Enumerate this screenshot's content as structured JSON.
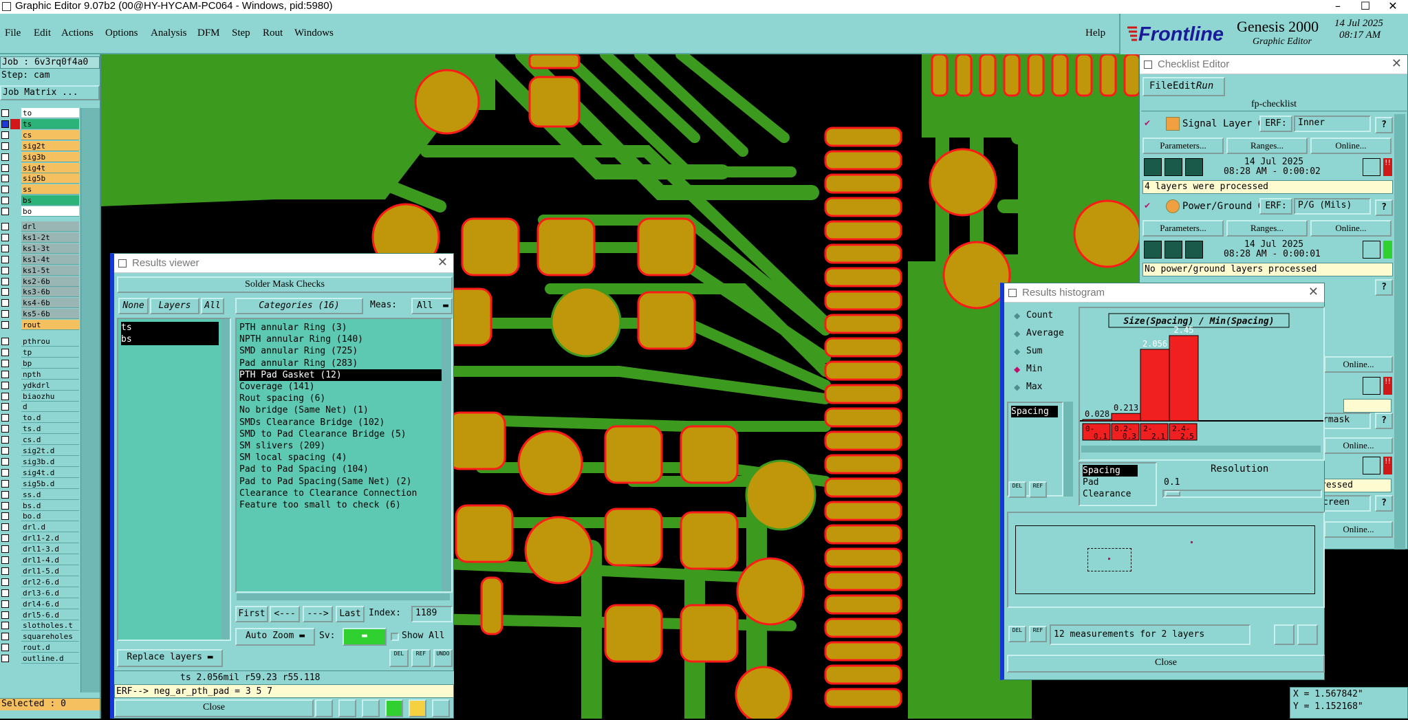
{
  "titlebar": {
    "title": "Graphic Editor 9.07b2 (00@HY-HYCAM-PC064 - Windows, pid:5980)",
    "minimize": "–",
    "maximize": "☐",
    "close": "✕"
  },
  "menu": {
    "items": [
      "File",
      "Edit",
      "Actions",
      "Options",
      "Analysis",
      "DFM",
      "Step",
      "Rout",
      "Windows"
    ],
    "help": "Help"
  },
  "brand": {
    "logo": "Frontline",
    "product": "Genesis 2000",
    "subtitle": "Graphic Editor",
    "date": "14 Jul 2025",
    "time": "08:17 AM"
  },
  "left": {
    "job": "Job : 6v3rq0f4a0",
    "step": "Step: cam",
    "job_matrix": "Job Matrix ...",
    "selected": "Selected : 0",
    "layers": [
      {
        "name": "to",
        "color": "#ffffff",
        "checked": false
      },
      {
        "name": "ts",
        "color": "#2bb37a",
        "checked": true
      },
      {
        "name": "cs",
        "color": "#f5c060",
        "checked": false
      },
      {
        "name": "sig2t",
        "color": "#f5c060",
        "checked": false
      },
      {
        "name": "sig3b",
        "color": "#f5c060",
        "checked": false
      },
      {
        "name": "sig4t",
        "color": "#f5c060",
        "checked": false
      },
      {
        "name": "sig5b",
        "color": "#f5c060",
        "checked": false
      },
      {
        "name": "ss",
        "color": "#f5c060",
        "checked": false
      },
      {
        "name": "bs",
        "color": "#2bb37a",
        "checked": false
      },
      {
        "name": "bo",
        "color": "#ffffff",
        "checked": false
      },
      {
        "name": "drl",
        "color": "#9ab6b4",
        "checked": false
      },
      {
        "name": "ks1-2t",
        "color": "#9ab6b4",
        "checked": false
      },
      {
        "name": "ks1-3t",
        "color": "#9ab6b4",
        "checked": false
      },
      {
        "name": "ks1-4t",
        "color": "#9ab6b4",
        "checked": false
      },
      {
        "name": "ks1-5t",
        "color": "#9ab6b4",
        "checked": false
      },
      {
        "name": "ks2-6b",
        "color": "#9ab6b4",
        "checked": false
      },
      {
        "name": "ks3-6b",
        "color": "#9ab6b4",
        "checked": false
      },
      {
        "name": "ks4-6b",
        "color": "#9ab6b4",
        "checked": false
      },
      {
        "name": "ks5-6b",
        "color": "#9ab6b4",
        "checked": false
      },
      {
        "name": "rout",
        "color": "#f5c060",
        "checked": false
      },
      {
        "name": "pthrou",
        "color": "#8fd6d2",
        "checked": false
      },
      {
        "name": "tp",
        "color": "#8fd6d2",
        "checked": false
      },
      {
        "name": "bp",
        "color": "#8fd6d2",
        "checked": false
      },
      {
        "name": "npth",
        "color": "#8fd6d2",
        "checked": false
      },
      {
        "name": "ydkdrl",
        "color": "#8fd6d2",
        "checked": false
      },
      {
        "name": "biaozhu",
        "color": "#8fd6d2",
        "checked": false
      },
      {
        "name": "d",
        "color": "#8fd6d2",
        "checked": false
      },
      {
        "name": "to.d",
        "color": "#8fd6d2",
        "checked": false
      },
      {
        "name": "ts.d",
        "color": "#8fd6d2",
        "checked": false
      },
      {
        "name": "cs.d",
        "color": "#8fd6d2",
        "checked": false
      },
      {
        "name": "sig2t.d",
        "color": "#8fd6d2",
        "checked": false
      },
      {
        "name": "sig3b.d",
        "color": "#8fd6d2",
        "checked": false
      },
      {
        "name": "sig4t.d",
        "color": "#8fd6d2",
        "checked": false
      },
      {
        "name": "sig5b.d",
        "color": "#8fd6d2",
        "checked": false
      },
      {
        "name": "ss.d",
        "color": "#8fd6d2",
        "checked": false
      },
      {
        "name": "bs.d",
        "color": "#8fd6d2",
        "checked": false
      },
      {
        "name": "bo.d",
        "color": "#8fd6d2",
        "checked": false
      },
      {
        "name": "drl.d",
        "color": "#8fd6d2",
        "checked": false
      },
      {
        "name": "drl1-2.d",
        "color": "#8fd6d2",
        "checked": false
      },
      {
        "name": "drl1-3.d",
        "color": "#8fd6d2",
        "checked": false
      },
      {
        "name": "drl1-4.d",
        "color": "#8fd6d2",
        "checked": false
      },
      {
        "name": "drl1-5.d",
        "color": "#8fd6d2",
        "checked": false
      },
      {
        "name": "drl2-6.d",
        "color": "#8fd6d2",
        "checked": false
      },
      {
        "name": "drl3-6.d",
        "color": "#8fd6d2",
        "checked": false
      },
      {
        "name": "drl4-6.d",
        "color": "#8fd6d2",
        "checked": false
      },
      {
        "name": "drl5-6.d",
        "color": "#8fd6d2",
        "checked": false
      },
      {
        "name": "slotholes.t",
        "color": "#8fd6d2",
        "checked": false
      },
      {
        "name": "squareholes",
        "color": "#8fd6d2",
        "checked": false
      },
      {
        "name": "rout.d",
        "color": "#8fd6d2",
        "checked": false
      },
      {
        "name": "outline.d",
        "color": "#8fd6d2",
        "checked": false
      }
    ]
  },
  "results_viewer": {
    "title": "Results viewer",
    "header": "Solder Mask Checks",
    "none": "None",
    "layers": "Layers",
    "all": "All",
    "categories": "Categories (16)",
    "meas_label": "Meas:",
    "meas_value": "All",
    "layer_list": [
      "ts",
      "bs"
    ],
    "category_list": [
      "PTH annular Ring (3)",
      "NPTH annular Ring (140)",
      "SMD annular Ring (725)",
      "Pad annular Ring (283)",
      "PTH Pad Gasket (12)",
      "Coverage (141)",
      "Rout spacing (6)",
      "No bridge (Same Net) (1)",
      "SMDs Clearance Bridge (102)",
      "SMD to Pad Clearance Bridge (5)",
      "SM slivers (209)",
      "SM local spacing (4)",
      "Pad to Pad Spacing (104)",
      "Pad to Pad Spacing(Same Net) (2)",
      "Clearance to Clearance Connection",
      "Feature too small to check (6)"
    ],
    "selected_index": 4,
    "first": "First",
    "prev": "<---",
    "next": "--->",
    "last": "Last",
    "index_label": "Index:",
    "index_value": "1189",
    "auto_zoom": "Auto Zoom",
    "sv": "Sv:",
    "show_all": "Show All",
    "replace_layers": "Replace layers",
    "status": "ts 2.056mil  r59.23  r55.118",
    "erf": "ERF--> neg_ar_pth_pad = 3 5 7",
    "close": "Close",
    "del": "DEL",
    "ref": "REF",
    "undo": "UNDO"
  },
  "checklist": {
    "title": "Checklist Editor",
    "menu": [
      "File",
      "Edit",
      "Run"
    ],
    "name": "fp-checklist",
    "actions": [
      {
        "name": "Signal Layer Ch",
        "erf": "ERF:",
        "erf_value": "Inner",
        "params": "Parameters...",
        "ranges": "Ranges...",
        "online": "Online...",
        "date": "14 Jul 2025",
        "time": "08:28 AM - 0:00:02",
        "message": "4 layers were processed",
        "status_color": "#d01818"
      },
      {
        "name": "Power/Ground C",
        "erf": "ERF:",
        "erf_value": "P/G (Mils)",
        "params": "Parameters...",
        "ranges": "Ranges...",
        "online": "Online...",
        "date": "14 Jul 2025",
        "time": "08:28 AM - 0:00:01",
        "message": "No power/ground layers processed",
        "status_color": "#2fd02f"
      }
    ],
    "partial": [
      "Online...",
      "Online...",
      "rmask",
      "Online...",
      "ressed",
      "creen",
      "Online..."
    ],
    "help": "?"
  },
  "histogram": {
    "title": "Results histogram",
    "options": [
      "Count",
      "Average",
      "Sum",
      "Min",
      "Max"
    ],
    "selected_option": "Min",
    "list": [
      "Spacing"
    ],
    "chart_title": "Size(Spacing) / Min(Spacing)",
    "measure_list": [
      "Spacing",
      "Pad",
      "Clearance"
    ],
    "resolution_label": "Resolution",
    "resolution_value": "0.1",
    "summary": "12 measurements for 2 layers",
    "close": "Close",
    "del": "DEL",
    "ref": "REF"
  },
  "chart_data": {
    "type": "bar",
    "title": "Size(Spacing) / Min(Spacing)",
    "categories": [
      "0-0.1",
      "0.2-0.3",
      "2-2.1",
      "2.4-2.5"
    ],
    "values": [
      0.028,
      0.213,
      2.056,
      2.45
    ],
    "value_labels": [
      "0.028",
      "0.213",
      "2.056",
      "2.45"
    ],
    "bar_color": "#f02020",
    "ylim": [
      0,
      2.45
    ]
  },
  "coords": {
    "x": "X = 1.567842\"",
    "y": "Y = 1.152168\""
  },
  "colors": {
    "ui": "#8fd6d2",
    "board_green": "#3c9a1e",
    "pad_gold": "#c0960a",
    "pad_outline": "#ff1a1a",
    "highlight": "#ffff33"
  }
}
